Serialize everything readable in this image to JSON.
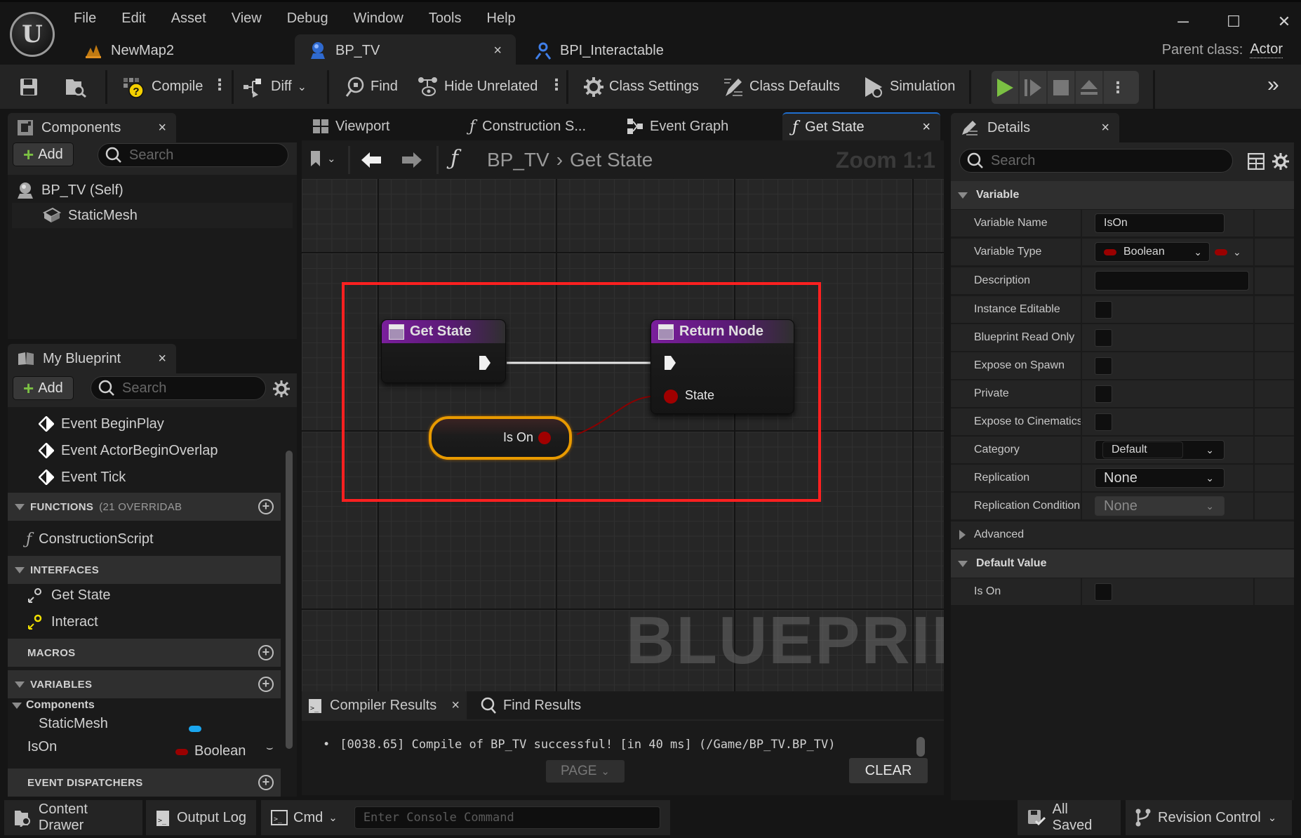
{
  "menu": [
    "File",
    "Edit",
    "Asset",
    "View",
    "Debug",
    "Window",
    "Tools",
    "Help"
  ],
  "document_tabs": [
    {
      "label": "NewMap2",
      "icon": "level-icon"
    },
    {
      "label": "BP_TV",
      "icon": "blueprint-actor-icon",
      "active": true
    },
    {
      "label": "BPI_Interactable",
      "icon": "blueprint-interface-icon"
    }
  ],
  "parent_class": {
    "label": "Parent class:",
    "value": "Actor"
  },
  "toolbar": {
    "compile": "Compile",
    "diff": "Diff",
    "find": "Find",
    "hide_unrelated": "Hide Unrelated",
    "class_settings": "Class Settings",
    "class_defaults": "Class Defaults",
    "simulation": "Simulation"
  },
  "components_panel": {
    "title": "Components",
    "add_label": "Add",
    "search_placeholder": "Search",
    "items": [
      {
        "label": "BP_TV (Self)"
      },
      {
        "label": "StaticMesh"
      }
    ]
  },
  "my_blueprint": {
    "title": "My Blueprint",
    "add_label": "Add",
    "search_placeholder": "Search",
    "events": [
      "Event BeginPlay",
      "Event ActorBeginOverlap",
      "Event Tick"
    ],
    "functions_header": "FUNCTIONS",
    "functions_sub": "(21 OVERRIDAB",
    "functions": [
      "ConstructionScript"
    ],
    "interfaces_header": "INTERFACES",
    "interfaces": [
      "Get State",
      "Interact"
    ],
    "macros_header": "MACROS",
    "variables_header": "VARIABLES",
    "variable_category": "Components",
    "variables": [
      {
        "name": "StaticMesh",
        "type": "",
        "color": "#1aa6ef"
      },
      {
        "name": "IsOn",
        "type": "Boolean",
        "color": "#9a0000"
      }
    ],
    "dispatchers_header": "EVENT DISPATCHERS"
  },
  "graph_tabs": [
    {
      "label": "Viewport"
    },
    {
      "label": "Construction S..."
    },
    {
      "label": "Event Graph"
    },
    {
      "label": "Get State",
      "active": true
    }
  ],
  "breadcrumb": {
    "root": "BP_TV",
    "current": "Get State",
    "zoom": "Zoom 1:1"
  },
  "graph": {
    "entry_node": "Get State",
    "return_node": "Return Node",
    "return_pin": "State",
    "variable_node": "Is On",
    "watermark": "BLUEPRINT"
  },
  "results": {
    "tabs": [
      "Compiler Results",
      "Find Results"
    ],
    "log": "[0038.65] Compile of BP_TV successful! [in 40 ms] (/Game/BP_TV.BP_TV)",
    "page_label": "PAGE",
    "clear_label": "CLEAR"
  },
  "details": {
    "title": "Details",
    "search_placeholder": "Search",
    "variable_group": "Variable",
    "variable_name_label": "Variable Name",
    "variable_name_value": "IsOn",
    "variable_type_label": "Variable Type",
    "variable_type_value": "Boolean",
    "description_label": "Description",
    "description_value": "",
    "checkbox_rows": [
      {
        "label": "Instance Editable",
        "checked": false
      },
      {
        "label": "Blueprint Read Only",
        "checked": false
      },
      {
        "label": "Expose on Spawn",
        "checked": false
      },
      {
        "label": "Private",
        "checked": false
      },
      {
        "label": "Expose to Cinematics",
        "checked": false
      }
    ],
    "category_label": "Category",
    "category_value": "Default",
    "replication_label": "Replication",
    "replication_value": "None",
    "replication_condition_label": "Replication Condition",
    "replication_condition_value": "None",
    "advanced_label": "Advanced",
    "default_value_group": "Default Value",
    "is_on_label": "Is On",
    "is_on_checked": false
  },
  "statusbar": {
    "content_drawer": "Content Drawer",
    "output_log": "Output Log",
    "cmd": "Cmd",
    "console_placeholder": "Enter Console Command",
    "all_saved": "All Saved",
    "revision_control": "Revision Control"
  },
  "colors": {
    "accent_blue": "#1f6fd0",
    "play_green": "#7bc043",
    "function_purple": "#7a1f9c",
    "bool_red": "#9a0000",
    "highlight_red": "#ff2020",
    "selected_orange": "#e89a00"
  }
}
